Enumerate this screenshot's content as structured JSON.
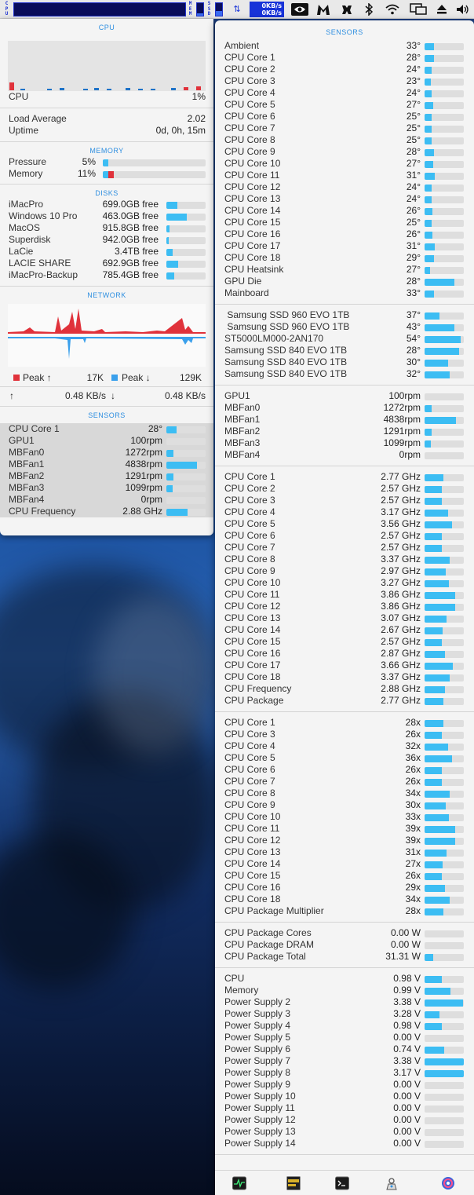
{
  "menubar": {
    "cpu_label": "CPU",
    "mem_label": "MEM",
    "ssd_label": "SSD",
    "net_up": "0KB/s",
    "net_down": "0KB/s",
    "mem_fill": 0.2,
    "ssd_fill": 0.35,
    "icons": [
      "nvidia-icon",
      "malwarebytes-icon",
      "game-controller-icon",
      "bluetooth-icon",
      "wifi-icon",
      "display-icon",
      "eject-icon",
      "volume-icon"
    ]
  },
  "left": {
    "cpu": {
      "title": "CPU",
      "label": "CPU",
      "value": "1%"
    },
    "load": {
      "load_label": "Load Average",
      "load_value": "2.02",
      "uptime_label": "Uptime",
      "uptime_value": "0d, 0h, 15m"
    },
    "memory": {
      "title": "MEMORY",
      "items": [
        {
          "name": "Pressure",
          "value": "5%",
          "fill": 0.05,
          "red": 0
        },
        {
          "name": "Memory",
          "value": "11%",
          "fill": 0.11,
          "red": 0.06
        }
      ]
    },
    "disks": {
      "title": "DISKS",
      "items": [
        {
          "name": "iMacPro",
          "value": "699.0GB free",
          "fill": 0.28
        },
        {
          "name": "Windows 10 Pro",
          "value": "463.0GB free",
          "fill": 0.52
        },
        {
          "name": "MacOS",
          "value": "915.8GB free",
          "fill": 0.08
        },
        {
          "name": "Superdisk",
          "value": "942.0GB free",
          "fill": 0.06
        },
        {
          "name": "LaCie",
          "value": "3.4TB free",
          "fill": 0.15
        },
        {
          "name": "LACIE SHARE",
          "value": "692.9GB free",
          "fill": 0.3
        },
        {
          "name": "iMacPro-Backup",
          "value": "785.4GB free",
          "fill": 0.2
        }
      ]
    },
    "network": {
      "title": "NETWORK",
      "peak_up_label": "Peak ↑",
      "peak_up_value": "17K",
      "peak_down_label": "Peak ↓",
      "peak_down_value": "129K",
      "up_arrow": "↑",
      "up_value": "0.48 KB/s",
      "down_arrow": "↓",
      "down_value": "0.48 KB/s",
      "up_color": "#e0323b",
      "down_color": "#3aa0ec"
    },
    "sensors": {
      "title": "SENSORS",
      "items": [
        {
          "name": "CPU Core 1",
          "value": "28°",
          "fill": 0.25
        },
        {
          "name": "GPU1",
          "value": "100rpm",
          "fill": 0
        },
        {
          "name": "MBFan0",
          "value": "1272rpm",
          "fill": 0.18
        },
        {
          "name": "MBFan1",
          "value": "4838rpm",
          "fill": 0.78
        },
        {
          "name": "MBFan2",
          "value": "1291rpm",
          "fill": 0.18
        },
        {
          "name": "MBFan3",
          "value": "1099rpm",
          "fill": 0.16
        },
        {
          "name": "MBFan4",
          "value": "0rpm",
          "fill": 0
        },
        {
          "name": "CPU Frequency",
          "value": "2.88 GHz",
          "fill": 0.54
        }
      ]
    }
  },
  "right": {
    "title": "SENSORS",
    "groups": [
      [
        {
          "name": "Ambient",
          "value": "33°",
          "fill": 0.24
        },
        {
          "name": "CPU Core 1",
          "value": "28°",
          "fill": 0.24
        },
        {
          "name": "CPU Core 2",
          "value": "24°",
          "fill": 0.18
        },
        {
          "name": "CPU Core 3",
          "value": "23°",
          "fill": 0.15
        },
        {
          "name": "CPU Core 4",
          "value": "24°",
          "fill": 0.18
        },
        {
          "name": "CPU Core 5",
          "value": "27°",
          "fill": 0.22
        },
        {
          "name": "CPU Core 6",
          "value": "25°",
          "fill": 0.18
        },
        {
          "name": "CPU Core 7",
          "value": "25°",
          "fill": 0.18
        },
        {
          "name": "CPU Core 8",
          "value": "25°",
          "fill": 0.18
        },
        {
          "name": "CPU Core 9",
          "value": "28°",
          "fill": 0.24
        },
        {
          "name": "CPU Core 10",
          "value": "27°",
          "fill": 0.22
        },
        {
          "name": "CPU Core 11",
          "value": "31°",
          "fill": 0.26
        },
        {
          "name": "CPU Core 12",
          "value": "24°",
          "fill": 0.18
        },
        {
          "name": "CPU Core 13",
          "value": "24°",
          "fill": 0.18
        },
        {
          "name": "CPU Core 14",
          "value": "26°",
          "fill": 0.2
        },
        {
          "name": "CPU Core 15",
          "value": "25°",
          "fill": 0.18
        },
        {
          "name": "CPU Core 16",
          "value": "26°",
          "fill": 0.2
        },
        {
          "name": "CPU Core 17",
          "value": "31°",
          "fill": 0.26
        },
        {
          "name": "CPU Core 18",
          "value": "29°",
          "fill": 0.24
        },
        {
          "name": "CPU Heatsink",
          "value": "27°",
          "fill": 0.14
        },
        {
          "name": "GPU Die",
          "value": "28°",
          "fill": 0.76
        },
        {
          "name": "Mainboard",
          "value": "33°",
          "fill": 0.24
        }
      ],
      [
        {
          "name": " Samsung SSD 960 EVO 1TB",
          "value": "37°",
          "fill": 0.38
        },
        {
          "name": " Samsung SSD 960 EVO 1TB",
          "value": "43°",
          "fill": 0.76
        },
        {
          "name": "ST5000LM000-2AN170",
          "value": "54°",
          "fill": 0.92
        },
        {
          "name": "Samsung SSD 840 EVO 1TB",
          "value": "28°",
          "fill": 0.88
        },
        {
          "name": "Samsung SSD 840 EVO 1TB",
          "value": "30°",
          "fill": 0.6
        },
        {
          "name": "Samsung SSD 840 EVO 1TB",
          "value": "32°",
          "fill": 0.64
        }
      ],
      [
        {
          "name": "GPU1",
          "value": "100rpm",
          "fill": 0
        },
        {
          "name": "MBFan0",
          "value": "1272rpm",
          "fill": 0.18
        },
        {
          "name": "MBFan1",
          "value": "4838rpm",
          "fill": 0.8
        },
        {
          "name": "MBFan2",
          "value": "1291rpm",
          "fill": 0.18
        },
        {
          "name": "MBFan3",
          "value": "1099rpm",
          "fill": 0.16
        },
        {
          "name": "MBFan4",
          "value": "0rpm",
          "fill": 0
        }
      ],
      [
        {
          "name": "CPU Core 1",
          "value": "2.77 GHz",
          "fill": 0.48
        },
        {
          "name": "CPU Core 2",
          "value": "2.57 GHz",
          "fill": 0.44
        },
        {
          "name": "CPU Core 3",
          "value": "2.57 GHz",
          "fill": 0.44
        },
        {
          "name": "CPU Core 4",
          "value": "3.17 GHz",
          "fill": 0.6
        },
        {
          "name": "CPU Core 5",
          "value": "3.56 GHz",
          "fill": 0.7
        },
        {
          "name": "CPU Core 6",
          "value": "2.57 GHz",
          "fill": 0.44
        },
        {
          "name": "CPU Core 7",
          "value": "2.57 GHz",
          "fill": 0.44
        },
        {
          "name": "CPU Core 8",
          "value": "3.37 GHz",
          "fill": 0.64
        },
        {
          "name": "CPU Core 9",
          "value": "2.97 GHz",
          "fill": 0.54
        },
        {
          "name": "CPU Core 10",
          "value": "3.27 GHz",
          "fill": 0.62
        },
        {
          "name": "CPU Core 11",
          "value": "3.86 GHz",
          "fill": 0.78
        },
        {
          "name": "CPU Core 12",
          "value": "3.86 GHz",
          "fill": 0.78
        },
        {
          "name": "CPU Core 13",
          "value": "3.07 GHz",
          "fill": 0.56
        },
        {
          "name": "CPU Core 14",
          "value": "2.67 GHz",
          "fill": 0.46
        },
        {
          "name": "CPU Core 15",
          "value": "2.57 GHz",
          "fill": 0.44
        },
        {
          "name": "CPU Core 16",
          "value": "2.87 GHz",
          "fill": 0.52
        },
        {
          "name": "CPU Core 17",
          "value": "3.66 GHz",
          "fill": 0.72
        },
        {
          "name": "CPU Core 18",
          "value": "3.37 GHz",
          "fill": 0.64
        },
        {
          "name": "CPU Frequency",
          "value": "2.88 GHz",
          "fill": 0.52
        },
        {
          "name": "CPU Package",
          "value": "2.77 GHz",
          "fill": 0.48
        }
      ],
      [
        {
          "name": "CPU Core 1",
          "value": "28x",
          "fill": 0.48
        },
        {
          "name": "CPU Core 3",
          "value": "26x",
          "fill": 0.44
        },
        {
          "name": "CPU Core 4",
          "value": "32x",
          "fill": 0.6
        },
        {
          "name": "CPU Core 5",
          "value": "36x",
          "fill": 0.7
        },
        {
          "name": "CPU Core 6",
          "value": "26x",
          "fill": 0.44
        },
        {
          "name": "CPU Core 7",
          "value": "26x",
          "fill": 0.44
        },
        {
          "name": "CPU Core 8",
          "value": "34x",
          "fill": 0.64
        },
        {
          "name": "CPU Core 9",
          "value": "30x",
          "fill": 0.54
        },
        {
          "name": "CPU Core 10",
          "value": "33x",
          "fill": 0.62
        },
        {
          "name": "CPU Core 11",
          "value": "39x",
          "fill": 0.78
        },
        {
          "name": "CPU Core 12",
          "value": "39x",
          "fill": 0.78
        },
        {
          "name": "CPU Core 13",
          "value": "31x",
          "fill": 0.56
        },
        {
          "name": "CPU Core 14",
          "value": "27x",
          "fill": 0.46
        },
        {
          "name": "CPU Core 15",
          "value": "26x",
          "fill": 0.44
        },
        {
          "name": "CPU Core 16",
          "value": "29x",
          "fill": 0.52
        },
        {
          "name": "CPU Core 18",
          "value": "34x",
          "fill": 0.64
        },
        {
          "name": "CPU Package Multiplier",
          "value": "28x",
          "fill": 0.48
        }
      ],
      [
        {
          "name": "CPU Package Cores",
          "value": "0.00 W",
          "fill": 0
        },
        {
          "name": "CPU Package DRAM",
          "value": "0.00 W",
          "fill": 0
        },
        {
          "name": "CPU Package Total",
          "value": "31.31 W",
          "fill": 0.22
        }
      ],
      [
        {
          "name": "CPU",
          "value": "0.98 V",
          "fill": 0.44
        },
        {
          "name": "Memory",
          "value": "0.99 V",
          "fill": 0.66
        },
        {
          "name": "Power Supply 2",
          "value": "3.38 V",
          "fill": 0.98
        },
        {
          "name": "Power Supply 3",
          "value": "3.28 V",
          "fill": 0.38
        },
        {
          "name": "Power Supply 4",
          "value": "0.98 V",
          "fill": 0.44
        },
        {
          "name": "Power Supply 5",
          "value": "0.00 V",
          "fill": 0
        },
        {
          "name": "Power Supply 6",
          "value": "0.74 V",
          "fill": 0.5
        },
        {
          "name": "Power Supply 7",
          "value": "3.38 V",
          "fill": 1.0
        },
        {
          "name": "Power Supply 8",
          "value": "3.17 V",
          "fill": 1.0
        },
        {
          "name": "Power Supply 9",
          "value": "0.00 V",
          "fill": 0
        },
        {
          "name": "Power Supply 10",
          "value": "0.00 V",
          "fill": 0
        },
        {
          "name": "Power Supply 11",
          "value": "0.00 V",
          "fill": 0
        },
        {
          "name": "Power Supply 12",
          "value": "0.00 V",
          "fill": 0
        },
        {
          "name": "Power Supply 13",
          "value": "0.00 V",
          "fill": 0
        },
        {
          "name": "Power Supply 14",
          "value": "0.00 V",
          "fill": 0
        }
      ]
    ],
    "footer_icons": [
      "activity-monitor-icon",
      "console-icon",
      "terminal-icon",
      "system-info-icon",
      "istat-menus-icon"
    ]
  }
}
